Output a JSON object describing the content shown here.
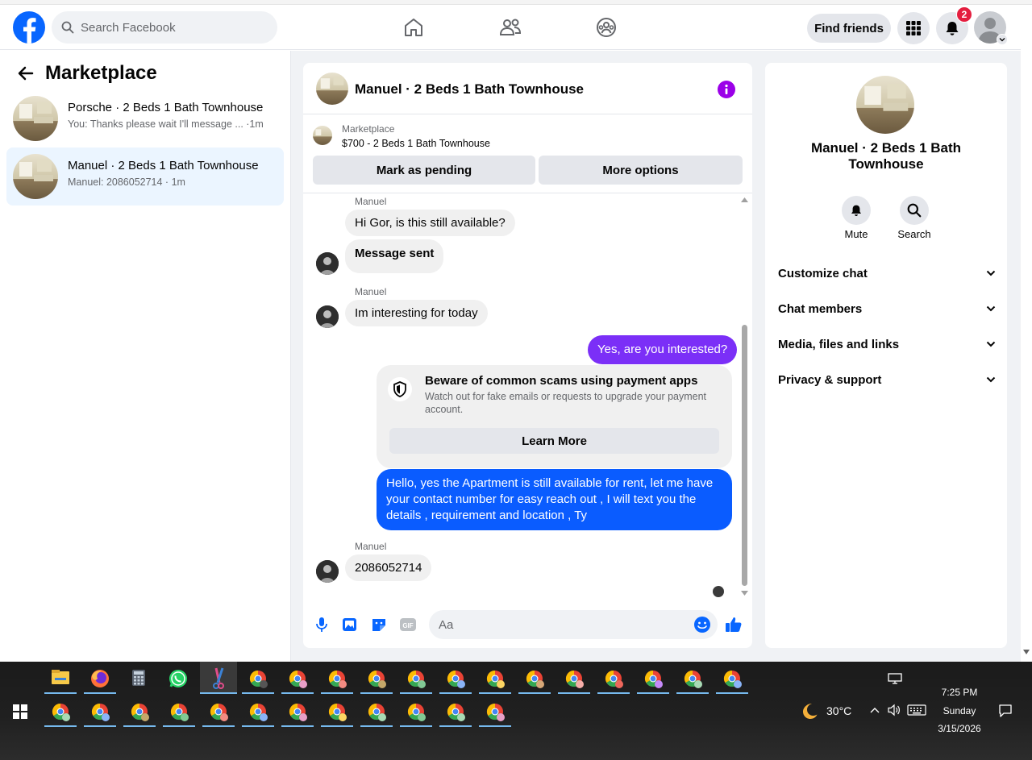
{
  "header": {
    "search_placeholder": "Search Facebook",
    "find_friends": "Find friends",
    "notification_count": "2"
  },
  "sidebar": {
    "title": "Marketplace",
    "conversations": [
      {
        "title": "Porsche · 2 Beds 1 Bath Townhouse",
        "subtitle": "You: Thanks please wait I'll message ... ·1m"
      },
      {
        "title": "Manuel · 2 Beds 1 Bath Townhouse",
        "subtitle": "Manuel: 2086052714 · 1m"
      }
    ]
  },
  "chat": {
    "title": "Manuel · 2 Beds 1 Bath Townhouse",
    "listing_label": "Marketplace",
    "listing_price": "$700 - 2 Beds 1 Bath Townhouse",
    "mark_pending": "Mark as pending",
    "more_options": "More options",
    "messages": {
      "sender1": "Manuel",
      "m1": "Hi Gor, is this still available?",
      "m2": "Message sent",
      "sender2": "Manuel",
      "m3": "Im interesting for today",
      "m4": "Yes, are you interested?",
      "card_title": "Beware of common scams using payment apps",
      "card_desc": "Watch out for fake emails or requests to upgrade your payment account.",
      "card_button": "Learn More",
      "m5": "Hello, yes the Apartment  is still available for rent, let me have your contact number for easy reach out , I will text you the details , requirement and location , Ty",
      "sender3": "Manuel",
      "m6": "2086052714"
    },
    "composer_placeholder": "Aa"
  },
  "details": {
    "title": "Manuel · 2 Beds 1 Bath Townhouse",
    "mute": "Mute",
    "search": "Search",
    "sections": [
      "Customize chat",
      "Chat members",
      "Media, files and links",
      "Privacy & support"
    ]
  },
  "taskbar": {
    "weather": "30°C",
    "time": "7:25 PM",
    "day": "Sunday",
    "date": "3/15/2026"
  },
  "colors": {
    "brand": "#0866ff",
    "outgoing_purple": "#7b2ff7",
    "outgoing_blue": "#0a5cff",
    "info": "#9b00e8"
  }
}
